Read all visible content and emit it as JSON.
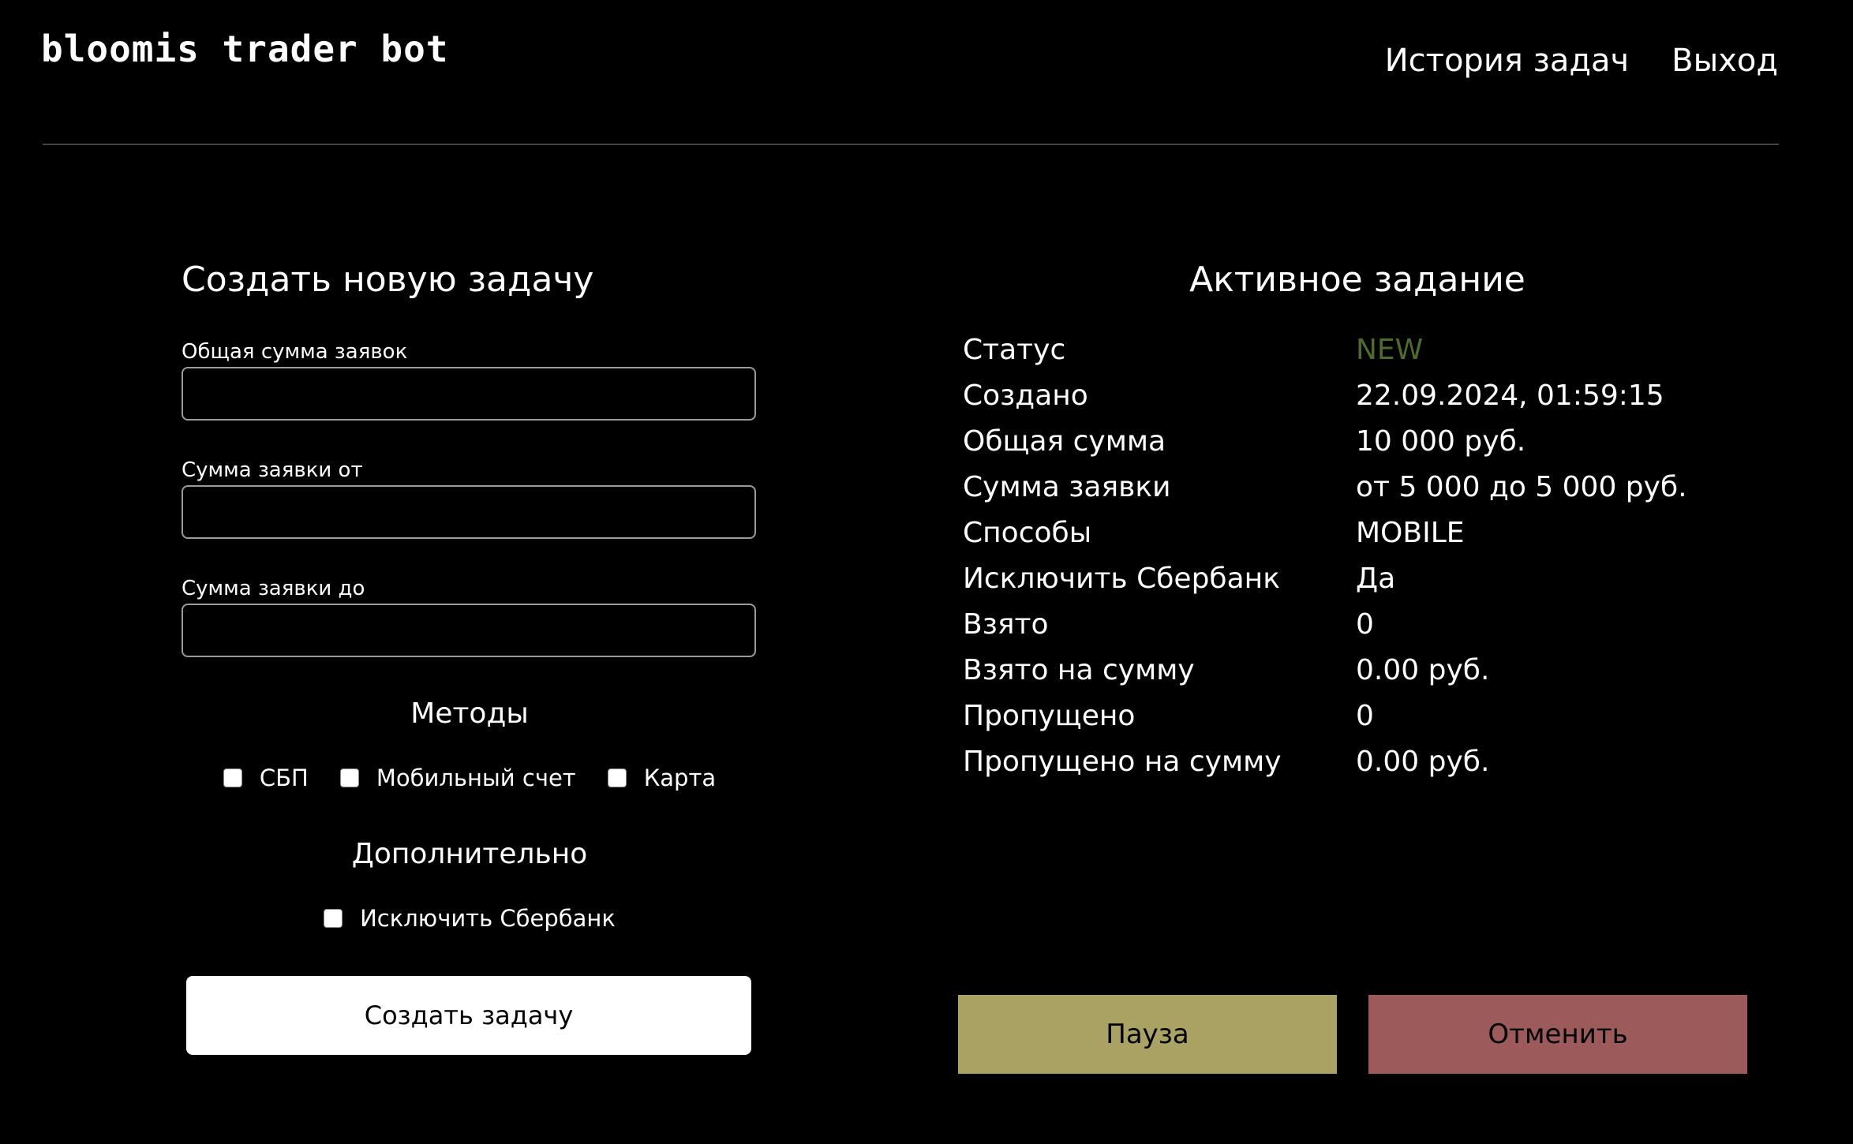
{
  "header": {
    "logo": "bloomis trader bot",
    "nav": [
      {
        "label": "История задач"
      },
      {
        "label": "Выход"
      }
    ]
  },
  "form": {
    "title": "Создать новую задачу",
    "fields": [
      {
        "label": "Общая сумма заявок",
        "value": ""
      },
      {
        "label": "Сумма заявки от",
        "value": ""
      },
      {
        "label": "Сумма заявки до",
        "value": ""
      }
    ],
    "methods_title": "Методы",
    "methods": [
      {
        "label": "СБП",
        "checked": false
      },
      {
        "label": "Мобильный счет",
        "checked": false
      },
      {
        "label": "Карта",
        "checked": false
      }
    ],
    "extra_title": "Дополнительно",
    "extra": [
      {
        "label": "Исключить Сбербанк",
        "checked": false
      }
    ],
    "submit_label": "Создать задачу"
  },
  "active": {
    "title": "Активное задание",
    "rows": [
      {
        "label": "Статус",
        "value": "NEW"
      },
      {
        "label": "Создано",
        "value": "22.09.2024, 01:59:15"
      },
      {
        "label": "Общая сумма",
        "value": "10 000 руб."
      },
      {
        "label": "Сумма заявки",
        "value": "от 5 000 до 5 000 руб."
      },
      {
        "label": "Способы",
        "value": "MOBILE"
      },
      {
        "label": "Исключить Сбербанк",
        "value": "Да"
      },
      {
        "label": "Взято",
        "value": "0"
      },
      {
        "label": "Взято на сумму",
        "value": "0.00 руб."
      },
      {
        "label": "Пропущено",
        "value": "0"
      },
      {
        "label": "Пропущено на сумму",
        "value": "0.00 руб."
      }
    ],
    "pause_label": "Пауза",
    "cancel_label": "Отменить"
  },
  "colors": {
    "background": "#000000",
    "status_new": "#4f6b2a",
    "pause_button": "#a9a263",
    "cancel_button": "#9c5a5a"
  }
}
